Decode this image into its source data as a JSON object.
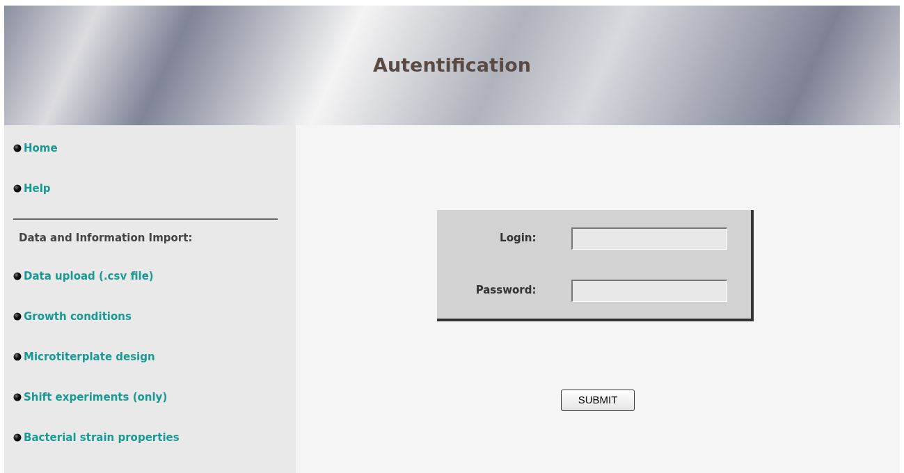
{
  "header": {
    "title": "Autentification"
  },
  "sidebar": {
    "items": [
      {
        "label": "Home"
      },
      {
        "label": "Help"
      }
    ],
    "section_heading": "Data and Information Import:",
    "section_items": [
      {
        "label": "Data upload (.csv file)"
      },
      {
        "label": "Growth conditions"
      },
      {
        "label": "Microtiterplate design"
      },
      {
        "label": "Shift experiments (only)"
      },
      {
        "label": "Bacterial strain properties"
      }
    ]
  },
  "form": {
    "fields": [
      {
        "label": "Login:"
      },
      {
        "label": "Password:"
      }
    ],
    "submit": "SUBMIT"
  }
}
